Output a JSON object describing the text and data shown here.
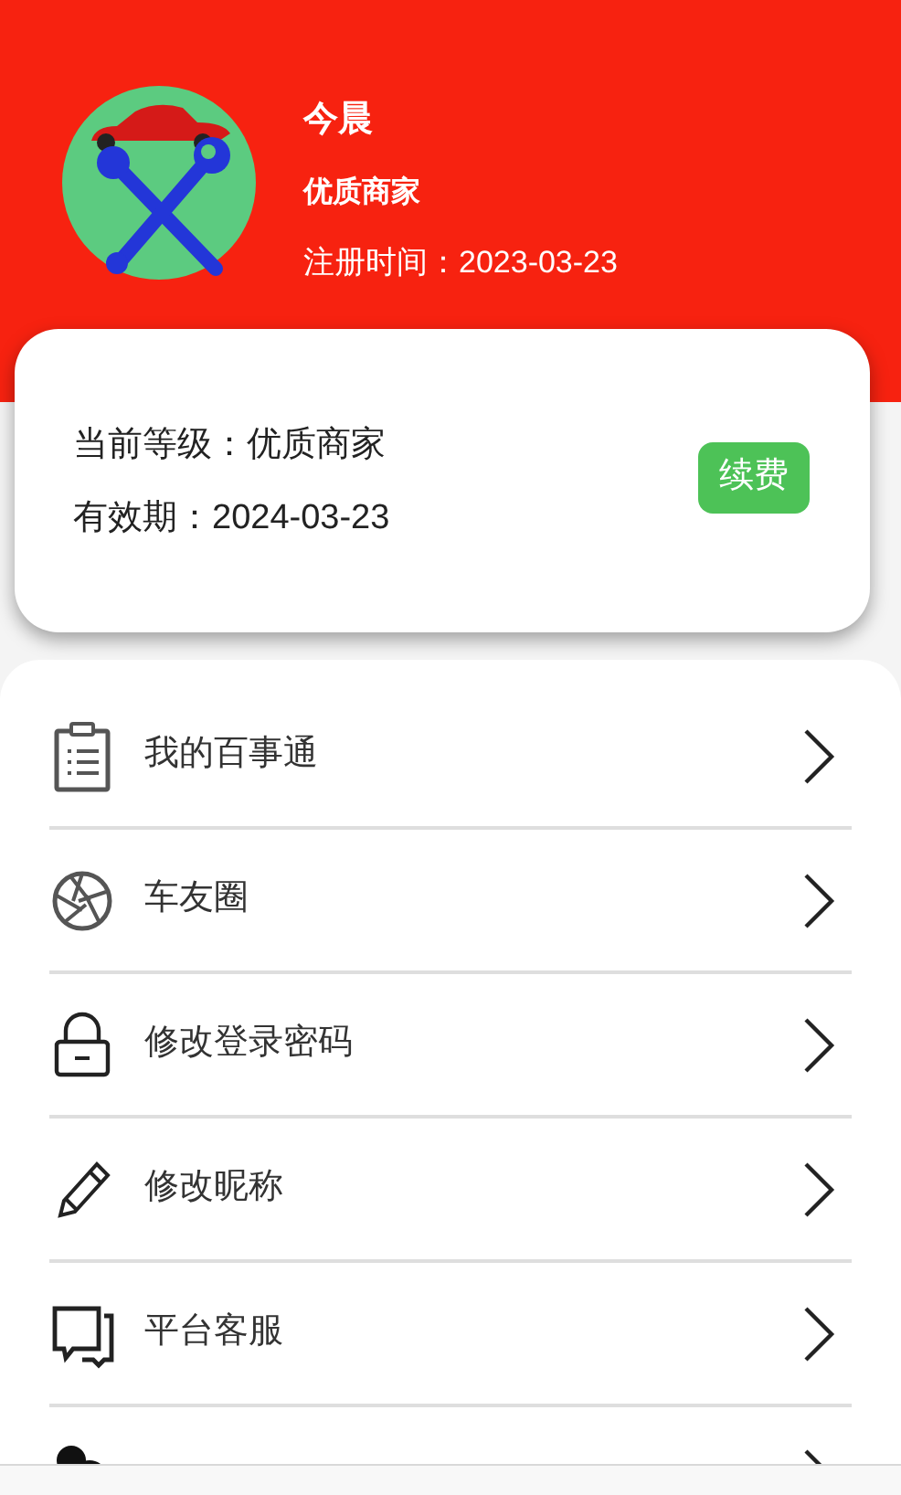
{
  "profile": {
    "name": "今晨",
    "badge": "优质商家",
    "registered": "注册时间：2023-03-23"
  },
  "membership": {
    "level": "当前等级：优质商家",
    "expiry": "有效期：2024-03-23",
    "renew_button": "续费"
  },
  "menu": [
    {
      "kind": "clipboard",
      "label": "我的百事通"
    },
    {
      "kind": "aperture",
      "label": "车友圈"
    },
    {
      "kind": "lock",
      "label": "修改登录密码"
    },
    {
      "kind": "pencil",
      "label": "修改昵称"
    },
    {
      "kind": "chat",
      "label": "平台客服"
    },
    {
      "kind": "people"
    }
  ]
}
